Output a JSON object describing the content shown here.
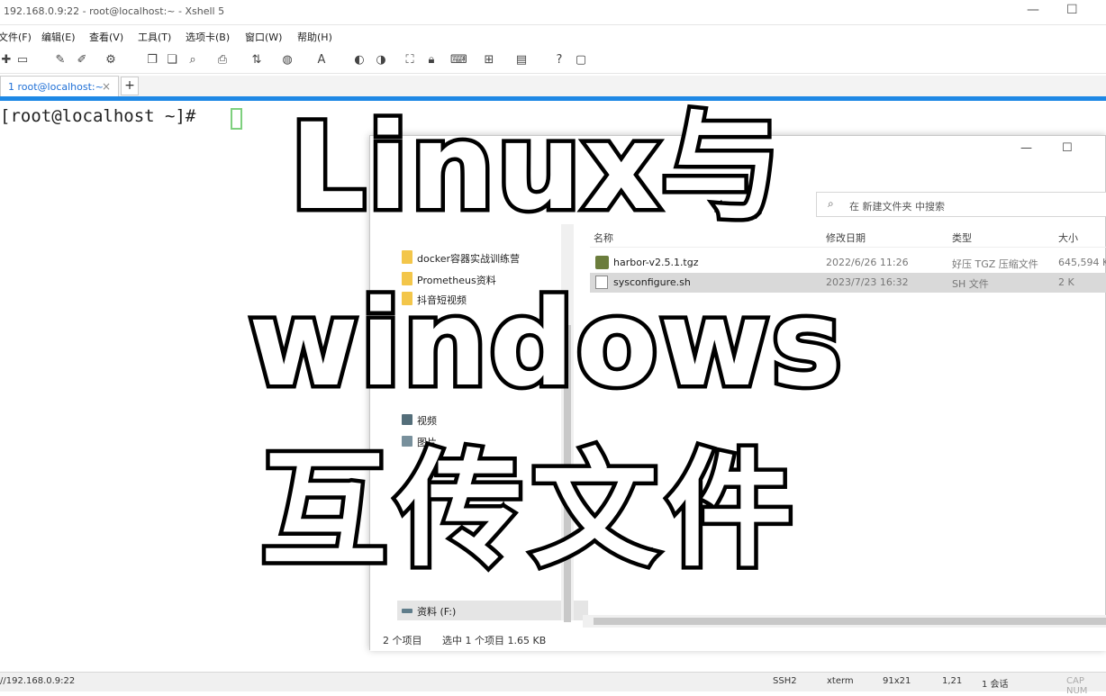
{
  "window": {
    "title": "192.168.0.9:22 - root@localhost:~ - Xshell 5",
    "minimize": "—",
    "maximize": "☐"
  },
  "menu": [
    "文件(F)",
    "编辑(E)",
    "查看(V)",
    "工具(T)",
    "选项卡(B)",
    "窗口(W)",
    "帮助(H)"
  ],
  "tab": {
    "label": "1 root@localhost:~",
    "close": "×",
    "add": "+"
  },
  "terminal": {
    "prompt": "[root@localhost ~]#"
  },
  "overlay": {
    "line1": "Linux与",
    "line2": "windows",
    "line3": "互传文件"
  },
  "explorer": {
    "minimize": "—",
    "maximize": "☐",
    "search_placeholder": "在 新建文件夹 中搜索",
    "nav_items": [
      {
        "label": "docker容器实战训练营"
      },
      {
        "label": "Prometheus资料"
      },
      {
        "label": "抖音短视频"
      },
      {
        "label": "视频"
      },
      {
        "label": "图片"
      },
      {
        "label": "资料 (F:)"
      }
    ],
    "columns": {
      "name": "名称",
      "modified": "修改日期",
      "type": "类型",
      "size": "大小"
    },
    "files": [
      {
        "name": "harbor-v2.5.1.tgz",
        "modified": "2022/6/26 11:26",
        "type": "好压 TGZ 压缩文件",
        "size": "645,594 K"
      },
      {
        "name": "sysconfigure.sh",
        "modified": "2023/7/23 16:32",
        "type": "SH 文件",
        "size": "2 K"
      }
    ],
    "status": {
      "count": "2 个项目",
      "selected": "选中 1 个项目  1.65 KB"
    }
  },
  "statusbar": {
    "address": "//192.168.0.9:22",
    "protocol": "SSH2",
    "term": "xterm",
    "size": "91x21",
    "pos": "1,21",
    "sessions": "1 会话",
    "caps": "CAP NUM"
  }
}
